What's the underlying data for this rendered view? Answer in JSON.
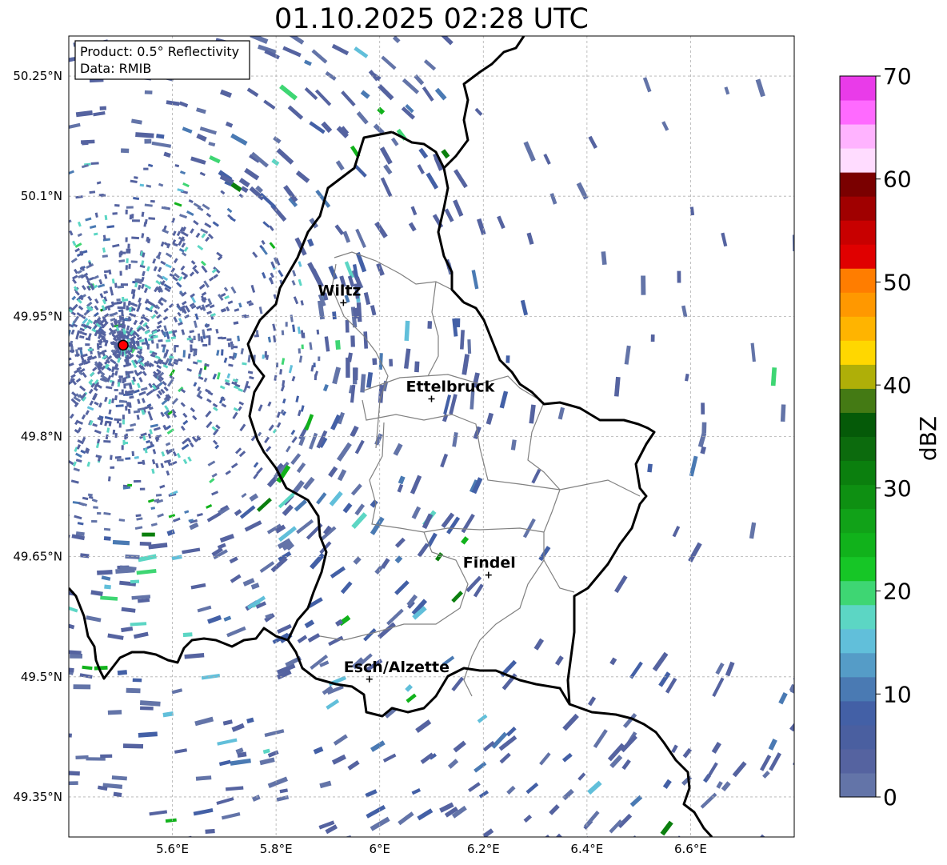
{
  "title": "01.10.2025 02:28 UTC",
  "info_box": {
    "product": "Product: 0.5° Reflectivity",
    "data_source": "Data: RMIB"
  },
  "axes": {
    "lat_ticks": [
      "50.25°N",
      "50.1°N",
      "49.95°N",
      "49.8°N",
      "49.65°N",
      "49.5°N",
      "49.35°N"
    ],
    "lon_ticks": [
      "5.6°E",
      "5.8°E",
      "6°E",
      "6.2°E",
      "6.4°E",
      "6.6°E"
    ],
    "lat_values": [
      50.25,
      50.1,
      49.95,
      49.8,
      49.65,
      49.5,
      49.35
    ],
    "lon_values": [
      5.6,
      5.8,
      6.0,
      6.2,
      6.4,
      6.6
    ],
    "lon_range": [
      5.4,
      6.8
    ],
    "lat_range": [
      49.3,
      50.3
    ],
    "grid": true
  },
  "cities": [
    {
      "name": "Wiltz",
      "lon": 5.93,
      "lat": 49.967
    },
    {
      "name": "Ettelbruck",
      "lon": 6.1,
      "lat": 49.847
    },
    {
      "name": "Findel",
      "lon": 6.21,
      "lat": 49.627
    },
    {
      "name": "Esch/Alzette",
      "lon": 5.98,
      "lat": 49.497
    }
  ],
  "radar_site": {
    "lon": 5.505,
    "lat": 49.914,
    "color": "#ff0000"
  },
  "colorbar": {
    "label": "dBZ",
    "ticks": [
      "0",
      "10",
      "20",
      "30",
      "40",
      "50",
      "60",
      "70"
    ],
    "range": [
      0,
      70
    ],
    "colors": [
      "#6374a8",
      "#5563a0",
      "#4a5fa0",
      "#4360a6",
      "#4a7ab3",
      "#559cc7",
      "#61bfda",
      "#5cd6c4",
      "#3ed673",
      "#16c626",
      "#11b21b",
      "#11a218",
      "#0e9012",
      "#0b7f0e",
      "#0c6b0d",
      "#055a08",
      "#447a14",
      "#afaf08",
      "#ffd700",
      "#ffb400",
      "#ff9800",
      "#ff7d00",
      "#e00000",
      "#c80000",
      "#a00000",
      "#7a0000",
      "#ffdcff",
      "#ffb3ff",
      "#ff6aff",
      "#e93be9"
    ]
  }
}
